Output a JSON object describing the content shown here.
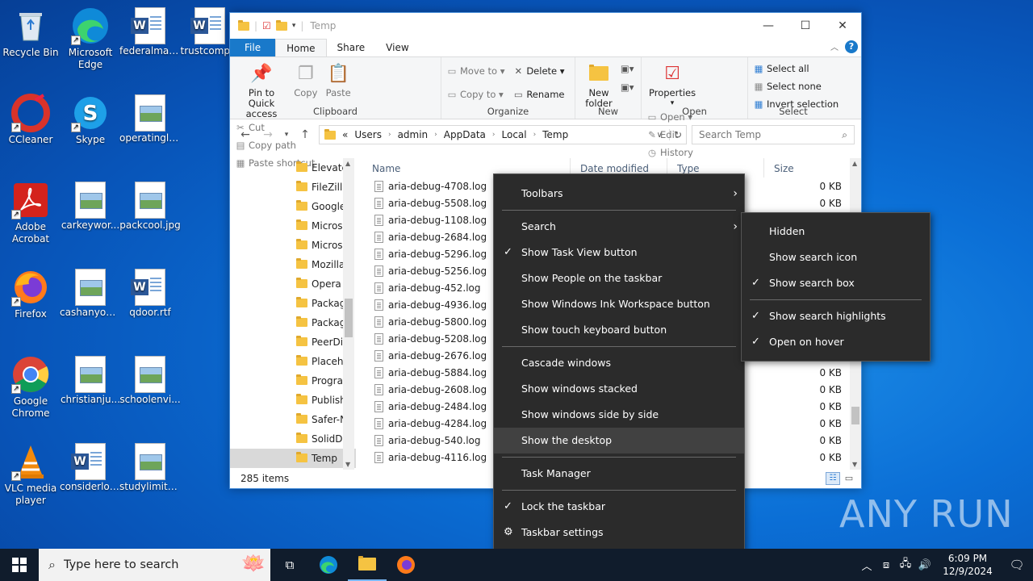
{
  "desktop_icons": [
    {
      "label": "Recycle Bin"
    },
    {
      "label": "Microsoft Edge"
    },
    {
      "label": "federalmak..."
    },
    {
      "label": "trustcomp..."
    },
    {
      "label": "CCleaner"
    },
    {
      "label": "Skype"
    },
    {
      "label": "operatingla..."
    },
    {
      "label": "Adobe Acrobat"
    },
    {
      "label": "carkeywor..."
    },
    {
      "label": "packcool.jpg"
    },
    {
      "label": "Firefox"
    },
    {
      "label": "cashanyon..."
    },
    {
      "label": "qdoor.rtf"
    },
    {
      "label": "Google Chrome"
    },
    {
      "label": "christianju..."
    },
    {
      "label": "schoolenvi..."
    },
    {
      "label": "VLC media player"
    },
    {
      "label": "considerlor..."
    },
    {
      "label": "studylimite..."
    }
  ],
  "explorer": {
    "title": "Temp",
    "tabs": [
      "File",
      "Home",
      "Share",
      "View"
    ],
    "ribbon": {
      "clipboard": {
        "name": "Clipboard",
        "pin": "Pin to Quick access",
        "copy": "Copy",
        "paste": "Paste",
        "cut": "Cut",
        "copy_path": "Copy path",
        "paste_shortcut": "Paste shortcut"
      },
      "organize": {
        "name": "Organize",
        "move_to": "Move to",
        "copy_to": "Copy to",
        "delete": "Delete",
        "rename": "Rename"
      },
      "new": {
        "name": "New",
        "new_folder": "New folder"
      },
      "open": {
        "name": "Open",
        "properties": "Properties",
        "open": "Open",
        "edit": "Edit",
        "history": "History"
      },
      "select": {
        "name": "Select",
        "select_all": "Select all",
        "select_none": "Select none",
        "invert": "Invert selection"
      }
    },
    "address": [
      "Users",
      "admin",
      "AppData",
      "Local",
      "Temp"
    ],
    "search_placeholder": "Search Temp",
    "nav_items": [
      "Elevate",
      "FileZilla",
      "Google",
      "Microso",
      "Microso",
      "Mozilla",
      "Opera",
      "Packag",
      "Packag",
      "PeerDis",
      "Placeho",
      "Progran",
      "Publish",
      "Safer-N",
      "SolidDo",
      "Temp"
    ],
    "columns": {
      "name": "Name",
      "date": "Date modified",
      "type": "Type",
      "size": "Size"
    },
    "files": [
      {
        "name": "aria-debug-4708.log",
        "size": "0 KB"
      },
      {
        "name": "aria-debug-5508.log",
        "size": "0 KB"
      },
      {
        "name": "aria-debug-1108.log",
        "size": ""
      },
      {
        "name": "aria-debug-2684.log",
        "size": ""
      },
      {
        "name": "aria-debug-5296.log",
        "size": ""
      },
      {
        "name": "aria-debug-5256.log",
        "size": ""
      },
      {
        "name": "aria-debug-452.log",
        "size": ""
      },
      {
        "name": "aria-debug-4936.log",
        "size": ""
      },
      {
        "name": "aria-debug-5800.log",
        "size": ""
      },
      {
        "name": "aria-debug-5208.log",
        "size": ""
      },
      {
        "name": "aria-debug-2676.log",
        "size": ""
      },
      {
        "name": "aria-debug-5884.log",
        "size": "0 KB"
      },
      {
        "name": "aria-debug-2608.log",
        "size": "0 KB"
      },
      {
        "name": "aria-debug-2484.log",
        "size": "0 KB"
      },
      {
        "name": "aria-debug-4284.log",
        "size": "0 KB"
      },
      {
        "name": "aria-debug-540.log",
        "size": "0 KB"
      },
      {
        "name": "aria-debug-4116.log",
        "size": "0 KB"
      }
    ],
    "status": "285 items"
  },
  "context_menu": {
    "toolbars": "Toolbars",
    "search": "Search",
    "task_view": "Show Task View button",
    "people": "Show People on the taskbar",
    "ink": "Show Windows Ink Workspace button",
    "touch_kb": "Show touch keyboard button",
    "cascade": "Cascade windows",
    "stacked": "Show windows stacked",
    "side_by_side": "Show windows side by side",
    "desktop": "Show the desktop",
    "task_manager": "Task Manager",
    "lock": "Lock the taskbar",
    "settings": "Taskbar settings"
  },
  "search_submenu": {
    "hidden": "Hidden",
    "icon": "Show search icon",
    "box": "Show search box",
    "highlights": "Show search highlights",
    "hover": "Open on hover"
  },
  "taskbar": {
    "search_placeholder": "Type here to search",
    "time": "6:09 PM",
    "date": "12/9/2024"
  },
  "watermark": "ANY RUN"
}
